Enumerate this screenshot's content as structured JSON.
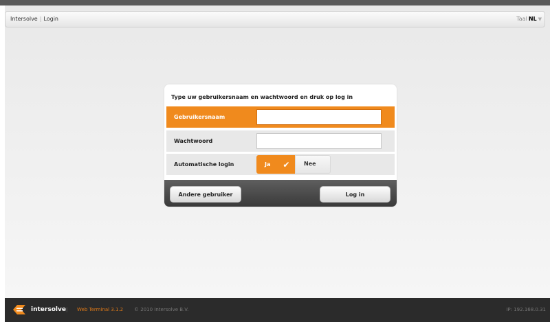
{
  "header": {
    "brand": "Intersolve",
    "separator": "|",
    "page": "Login",
    "lang_label": "Taal",
    "lang_code": "NL",
    "lang_chevron": "▼"
  },
  "login": {
    "instruction": "Type uw gebruikersnaam en wachtwoord en druk op log in",
    "username_label": "Gebruikersnaam",
    "username_value": "",
    "password_label": "Wachtwoord",
    "password_value": "",
    "autologin_label": "Automatische login",
    "autologin_yes": "Ja",
    "autologin_no": "Nee",
    "autologin_selected": "Ja",
    "other_user_button": "Andere gebruiker",
    "login_button": "Log in"
  },
  "footer": {
    "brand": "intersolve",
    "separator": "|",
    "product": "Web Terminal 3.1.2",
    "copyright": "© 2010 Intersolve B.V.",
    "ip": "IP: 192.168.0.31"
  },
  "colors": {
    "accent": "#f08a1d",
    "footer_bg": "#2b2b2b",
    "dialog_footer": "#4a4a4a"
  }
}
